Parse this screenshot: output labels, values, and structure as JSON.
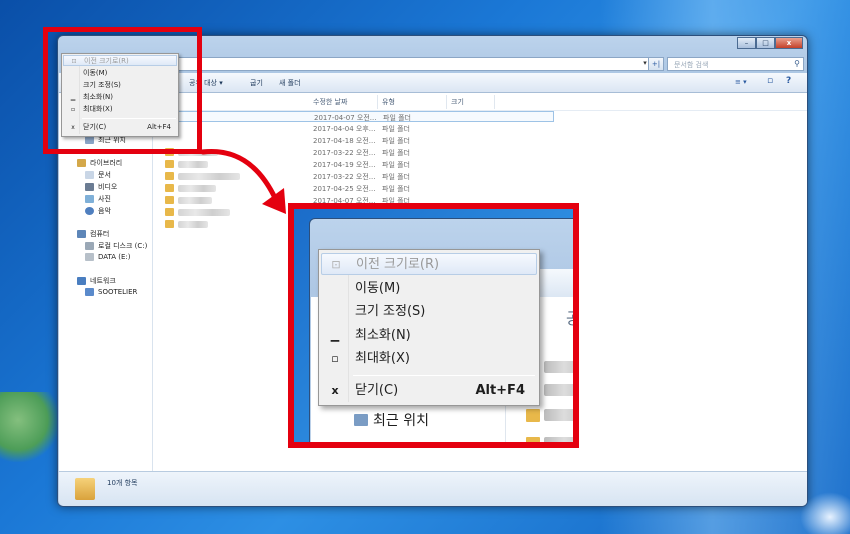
{
  "window": {
    "title_buttons": {
      "minimize": "–",
      "maximize": "□",
      "close": "x"
    },
    "search_placeholder": "문서함 검색",
    "address_dropdown": "▾",
    "refresh": "+|",
    "search_icon": "search-icon"
  },
  "toolbar": {
    "share_label": "공유 대상 ▾",
    "burn_label": "굽기",
    "new_folder_label": "새 폴더",
    "view_icon": "≡ ▾",
    "preview_icon": "▫",
    "help_icon": "?"
  },
  "nav": {
    "recent": "최근 위치",
    "library": "라이브러리",
    "documents": "문서",
    "videos": "비디오",
    "pictures": "사진",
    "music": "음악",
    "computer": "컴퓨터",
    "local_disk": "로컬 디스크 (C:)",
    "data_disk": "DATA (E:)",
    "network": "네트워크",
    "network_pc": "SOOTELIER"
  },
  "columns": {
    "modified": "수정한 날짜",
    "type": "유형",
    "size": "크기"
  },
  "files": [
    {
      "date": "2017-04-07 오전...",
      "type": "파일 폴더"
    },
    {
      "date": "2017-04-04 오후...",
      "type": "파일 폴더"
    },
    {
      "date": "2017-04-18 오전...",
      "type": "파일 폴더"
    },
    {
      "date": "2017-03-22 오전...",
      "type": "파일 폴더"
    },
    {
      "date": "2017-04-19 오전...",
      "type": "파일 폴더"
    },
    {
      "date": "2017-03-22 오전...",
      "type": "파일 폴더"
    },
    {
      "date": "2017-04-25 오전...",
      "type": "파일 폴더"
    },
    {
      "date": "2017-04-07 오전...",
      "type": "파일 폴더"
    }
  ],
  "status": {
    "count": "10개 항목"
  },
  "system_menu": {
    "items": [
      {
        "glyph": "⊡",
        "label": "이전 크기로(R)",
        "shortcut": ""
      },
      {
        "glyph": "",
        "label": "이동(M)",
        "shortcut": ""
      },
      {
        "glyph": "",
        "label": "크기 조정(S)",
        "shortcut": ""
      },
      {
        "glyph": "▁",
        "label": "최소화(N)",
        "shortcut": ""
      },
      {
        "glyph": "▫",
        "label": "최대화(X)",
        "shortcut": ""
      },
      {
        "glyph": "x",
        "label": "닫기(C)",
        "shortcut": "Alt+F4"
      }
    ]
  },
  "zoom": {
    "nav_recent": "최근 위치",
    "toolbar_glyph": "공"
  },
  "colors": {
    "highlight": "#e4000f",
    "accent": "#2a5aa0"
  }
}
